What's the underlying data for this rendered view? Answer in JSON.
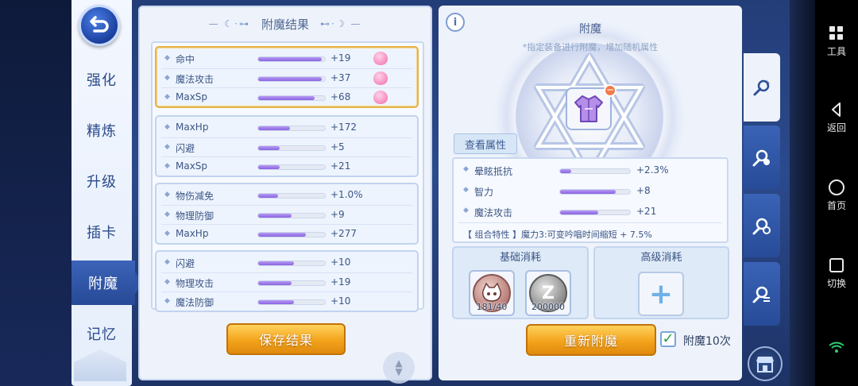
{
  "sidebar": {
    "tabs": [
      {
        "label": "强化"
      },
      {
        "label": "精炼"
      },
      {
        "label": "升级"
      },
      {
        "label": "插卡"
      },
      {
        "label": "附魔"
      },
      {
        "label": "记忆"
      }
    ],
    "active_index": 4
  },
  "results": {
    "title": "附魔结果",
    "groups": [
      {
        "rows": [
          {
            "name": "命中",
            "value": "+19",
            "fill": 0.95,
            "poring": true
          },
          {
            "name": "魔法攻击",
            "value": "+37",
            "fill": 0.95,
            "poring": true
          },
          {
            "name": "MaxSp",
            "value": "+68",
            "fill": 0.85,
            "poring": true
          }
        ]
      },
      {
        "rows": [
          {
            "name": "MaxHp",
            "value": "+172",
            "fill": 0.48
          },
          {
            "name": "闪避",
            "value": "+5",
            "fill": 0.32
          },
          {
            "name": "MaxSp",
            "value": "+21",
            "fill": 0.32
          }
        ]
      },
      {
        "rows": [
          {
            "name": "物伤减免",
            "value": "+1.0%",
            "fill": 0.3
          },
          {
            "name": "物理防御",
            "value": "+9",
            "fill": 0.5
          },
          {
            "name": "MaxHp",
            "value": "+277",
            "fill": 0.72
          }
        ]
      },
      {
        "rows": [
          {
            "name": "闪避",
            "value": "+10",
            "fill": 0.53
          },
          {
            "name": "物理攻击",
            "value": "+19",
            "fill": 0.5
          },
          {
            "name": "魔法防御",
            "value": "+10",
            "fill": 0.53
          }
        ]
      }
    ],
    "save_label": "保存结果"
  },
  "enchant": {
    "info_label": "i",
    "title": "附魔",
    "subtitle": "*指定装备进行附魔，增加随机属性",
    "view_attr_label": "查看属性",
    "attributes": [
      {
        "name": "晕眩抵抗",
        "value": "+2.3%",
        "fill": 0.16
      },
      {
        "name": "智力",
        "value": "+8",
        "fill": 0.8
      },
      {
        "name": "魔法攻击",
        "value": "+21",
        "fill": 0.55
      }
    ],
    "combo": "【 组合特性 】魔力3:可变吟唱时间缩短 + 7.5%",
    "basic_cost_title": "基础消耗",
    "advanced_cost_title": "高级消耗",
    "materials": [
      {
        "icon": "cat-coin-icon",
        "count": "181/40"
      },
      {
        "icon": "zeny-coin-icon",
        "symbol": "Z",
        "count": "200000"
      }
    ],
    "reenchant_label": "重新附魔",
    "checkbox_label": "附魔10次",
    "checkbox_checked": true
  },
  "android_nav": [
    {
      "label": "工具",
      "icon": "grid-icon"
    },
    {
      "label": "返回",
      "icon": "back-icon"
    },
    {
      "label": "首页",
      "icon": "home-icon"
    },
    {
      "label": "切换",
      "icon": "recent-apps-icon"
    }
  ],
  "colors": {
    "accent_orange": "#f3a31c",
    "bar_purple": "#8a63e0",
    "highlight_gold": "#e6b34a",
    "tab_blue": "#2e54a4"
  }
}
